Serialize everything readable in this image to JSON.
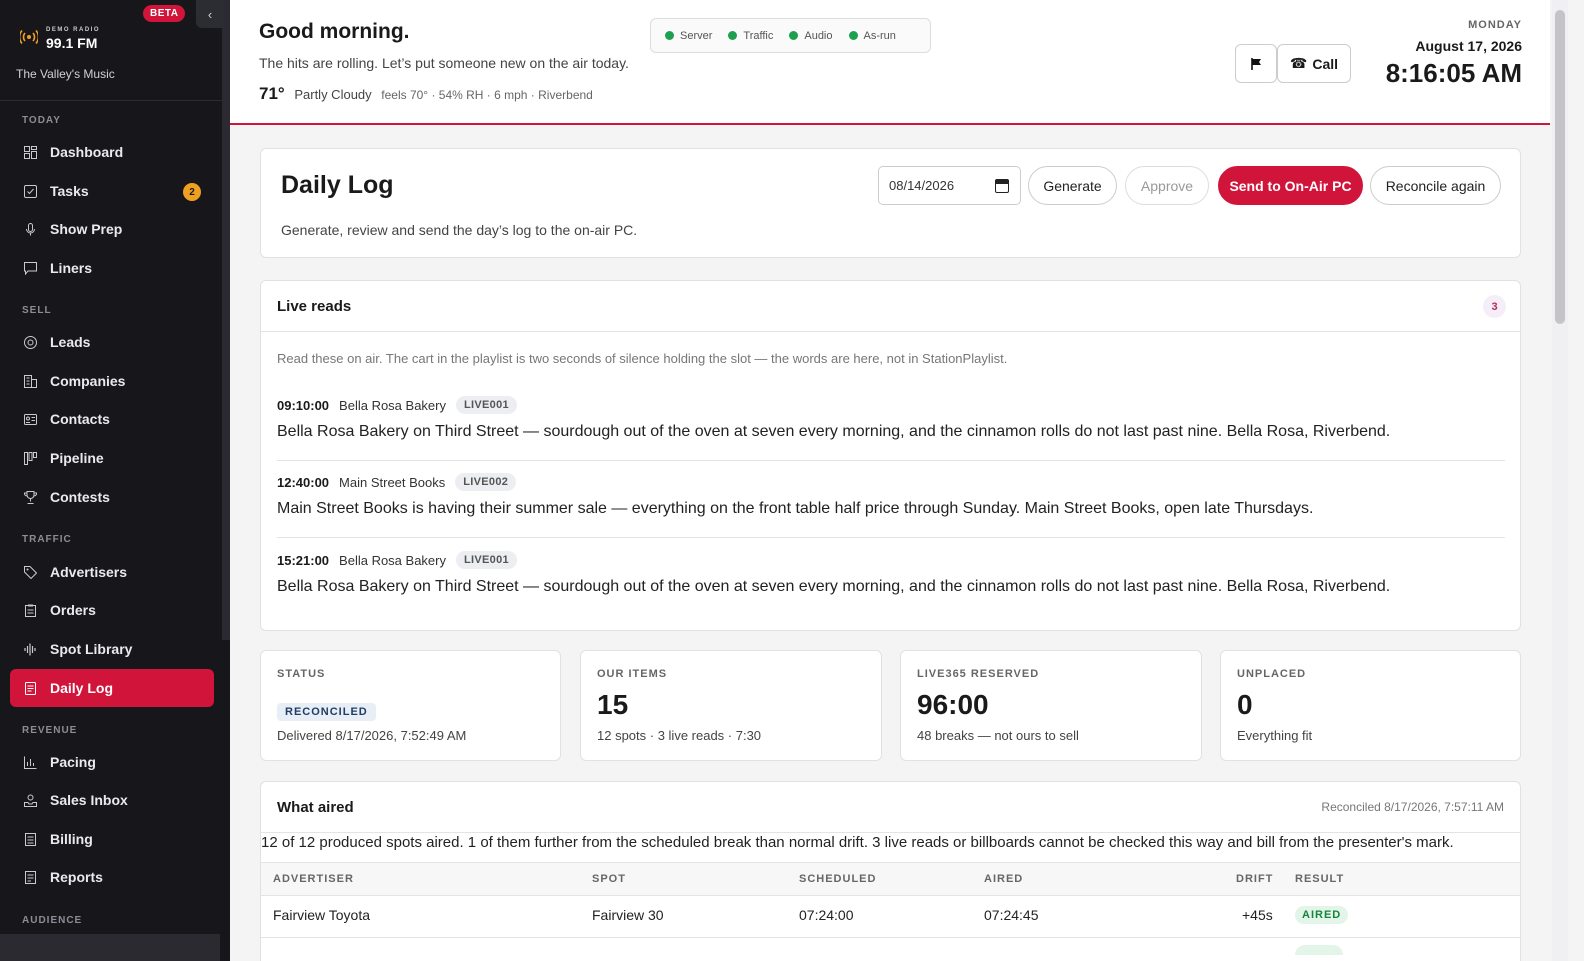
{
  "brand": {
    "station_kicker": "DEMO RADIO",
    "frequency": "99.1 FM",
    "beta": "BETA",
    "tagline": "The Valley's Music"
  },
  "sidebar": {
    "sections": {
      "today": "TODAY",
      "sell": "SELL",
      "traffic": "TRAFFIC",
      "revenue": "REVENUE",
      "audience": "AUDIENCE"
    },
    "items": {
      "dashboard": "Dashboard",
      "tasks": "Tasks",
      "tasks_count": "2",
      "show_prep": "Show Prep",
      "liners": "Liners",
      "leads": "Leads",
      "companies": "Companies",
      "contacts": "Contacts",
      "pipeline": "Pipeline",
      "contests": "Contests",
      "advertisers": "Advertisers",
      "orders": "Orders",
      "spot_library": "Spot Library",
      "daily_log": "Daily Log",
      "pacing": "Pacing",
      "sales_inbox": "Sales Inbox",
      "billing": "Billing",
      "reports": "Reports"
    }
  },
  "header": {
    "greeting": "Good morning.",
    "subtitle": "The hits are rolling. Let’s put someone new on the air today.",
    "temp": "71°",
    "condition": "Partly Cloudy",
    "weather_extra": "feels 70° · 54% RH · 6 mph · Riverbend",
    "statuses": [
      "Server",
      "Traffic",
      "Audio",
      "As-run"
    ],
    "call_label": "Call",
    "day": "MONDAY",
    "date": "August 17, 2026",
    "time": "8:16:05 AM"
  },
  "daily_log": {
    "title": "Daily Log",
    "subtitle": "Generate, review and send the day’s log to the on-air PC.",
    "date_value": "08/14/2026",
    "generate": "Generate",
    "approve": "Approve",
    "send": "Send to On-Air PC",
    "reconcile": "Reconcile again"
  },
  "live_reads": {
    "title": "Live reads",
    "count": "3",
    "note": "Read these on air. The cart in the playlist is two seconds of silence holding the slot — the words are here, not in StationPlaylist.",
    "items": [
      {
        "time": "09:10:00",
        "advertiser": "Bella Rosa Bakery",
        "cart": "LIVE001",
        "copy": "Bella Rosa Bakery on Third Street — sourdough out of the oven at seven every morning, and the cinnamon rolls do not last past nine. Bella Rosa, Riverbend."
      },
      {
        "time": "12:40:00",
        "advertiser": "Main Street Books",
        "cart": "LIVE002",
        "copy": "Main Street Books is having their summer sale — everything on the front table half price through Sunday. Main Street Books, open late Thursdays."
      },
      {
        "time": "15:21:00",
        "advertiser": "Bella Rosa Bakery",
        "cart": "LIVE001",
        "copy": "Bella Rosa Bakery on Third Street — sourdough out of the oven at seven every morning, and the cinnamon rolls do not last past nine. Bella Rosa, Riverbend."
      }
    ]
  },
  "stats": {
    "status_label": "STATUS",
    "status_badge": "RECONCILED",
    "status_detail": "Delivered 8/17/2026, 7:52:49 AM",
    "items_label": "OUR ITEMS",
    "items_value": "15",
    "items_detail": "12 spots · 3 live reads · 7:30",
    "reserved_label": "LIVE365 RESERVED",
    "reserved_value": "96:00",
    "reserved_detail": "48 breaks — not ours to sell",
    "unplaced_label": "UNPLACED",
    "unplaced_value": "0",
    "unplaced_detail": "Everything fit"
  },
  "what_aired": {
    "title": "What aired",
    "reconciled": "Reconciled 8/17/2026, 7:57:11 AM",
    "summary": "12 of 12 produced spots aired. 1 of them further from the scheduled break than normal drift. 3 live reads or billboards cannot be checked this way and bill from the presenter's mark.",
    "columns": {
      "advertiser": "ADVERTISER",
      "spot": "SPOT",
      "scheduled": "SCHEDULED",
      "aired": "AIRED",
      "drift": "DRIFT",
      "result": "RESULT"
    },
    "rows": [
      {
        "advertiser": "Fairview Toyota",
        "spot": "Fairview 30",
        "scheduled": "07:24:00",
        "aired": "07:24:45",
        "drift": "+45s",
        "result": "AIRED"
      }
    ]
  }
}
